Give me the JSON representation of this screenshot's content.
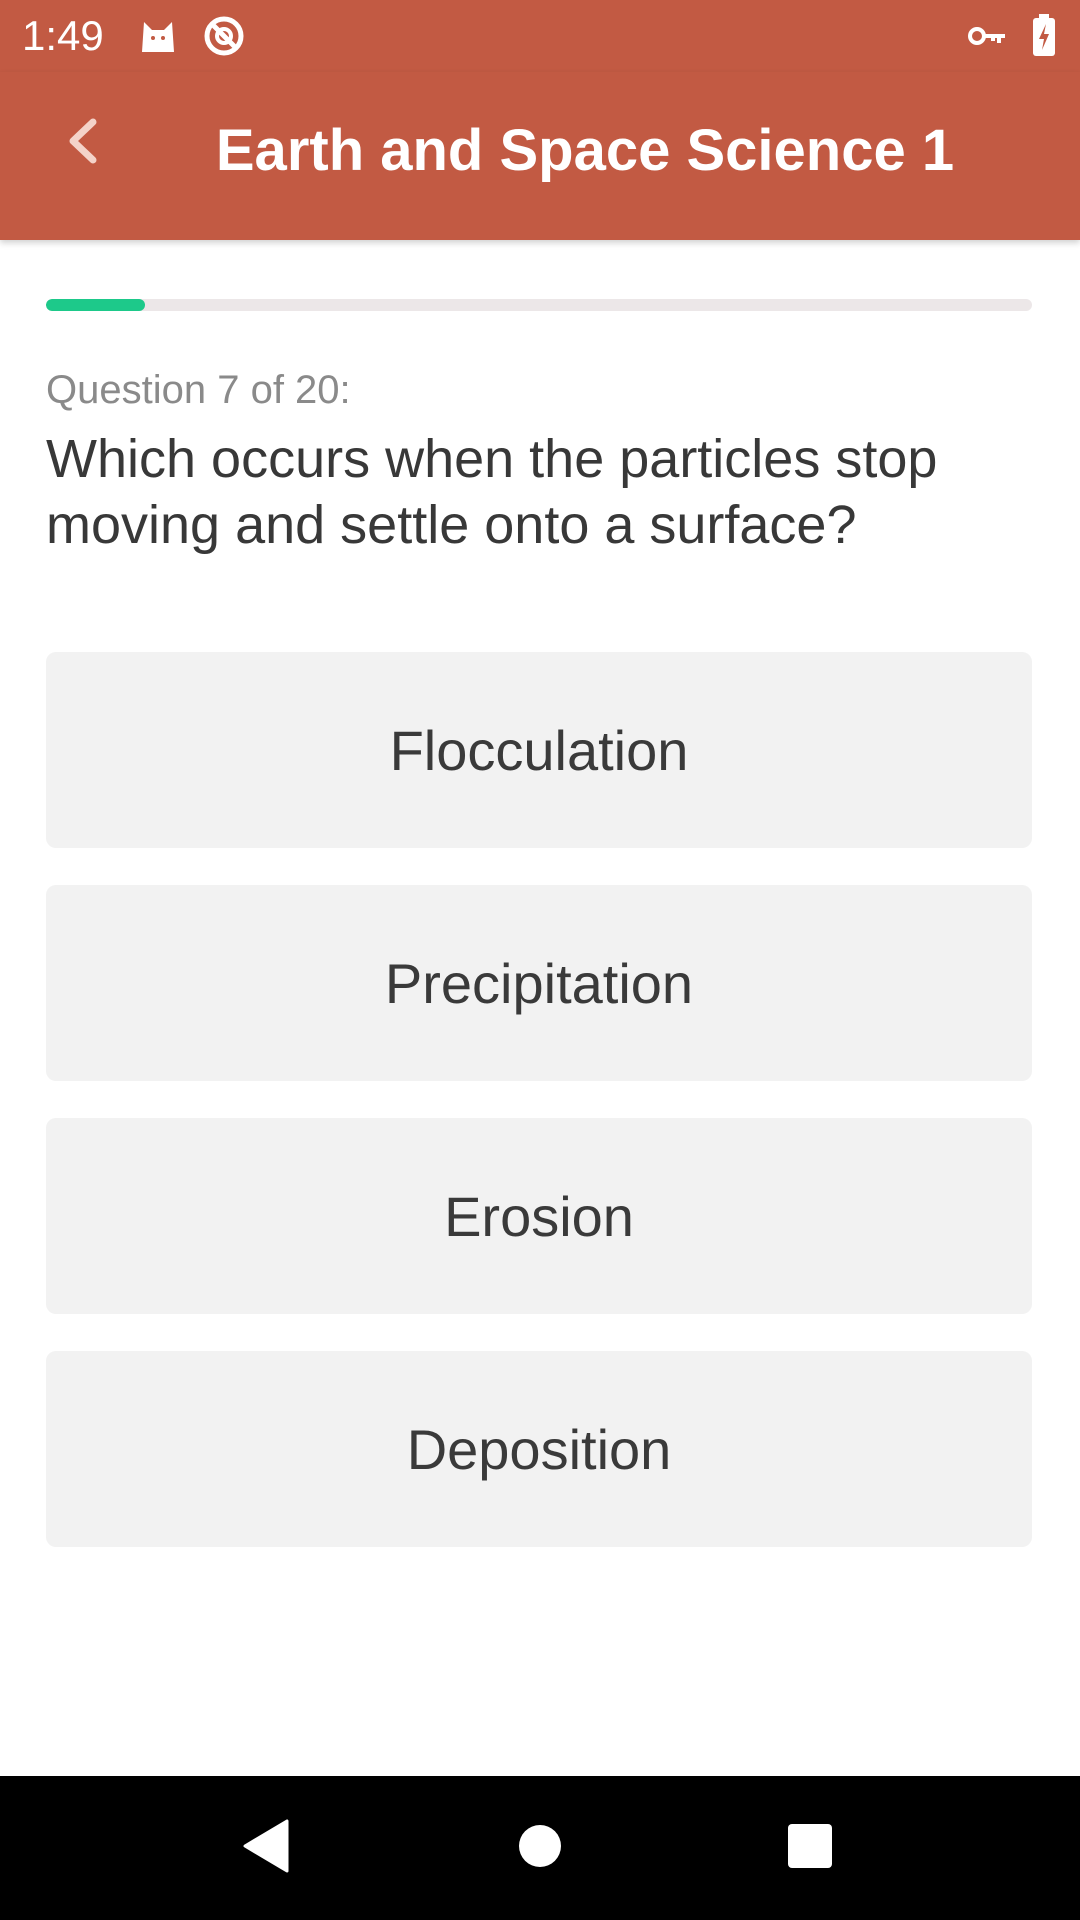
{
  "status_bar": {
    "time": "1:49",
    "icons": [
      "cat-notification-icon",
      "blocked-icon",
      "vpn-key-icon",
      "battery-charging-icon"
    ]
  },
  "app_bar": {
    "title": "Earth and Space Science 1",
    "back_icon": "chevron-left-icon",
    "background_color": "#C25A43"
  },
  "quiz": {
    "progress_fraction": 0.1,
    "progress_color": "#1DC98A",
    "counter": "Question 7 of 20:",
    "question": "Which occurs when the particles stop moving and settle onto a surface?",
    "answers": [
      "Flocculation",
      "Precipitation",
      "Erosion",
      "Deposition"
    ]
  },
  "nav_bar": {
    "icons": [
      "back-triangle-icon",
      "home-circle-icon",
      "recents-square-icon"
    ]
  }
}
